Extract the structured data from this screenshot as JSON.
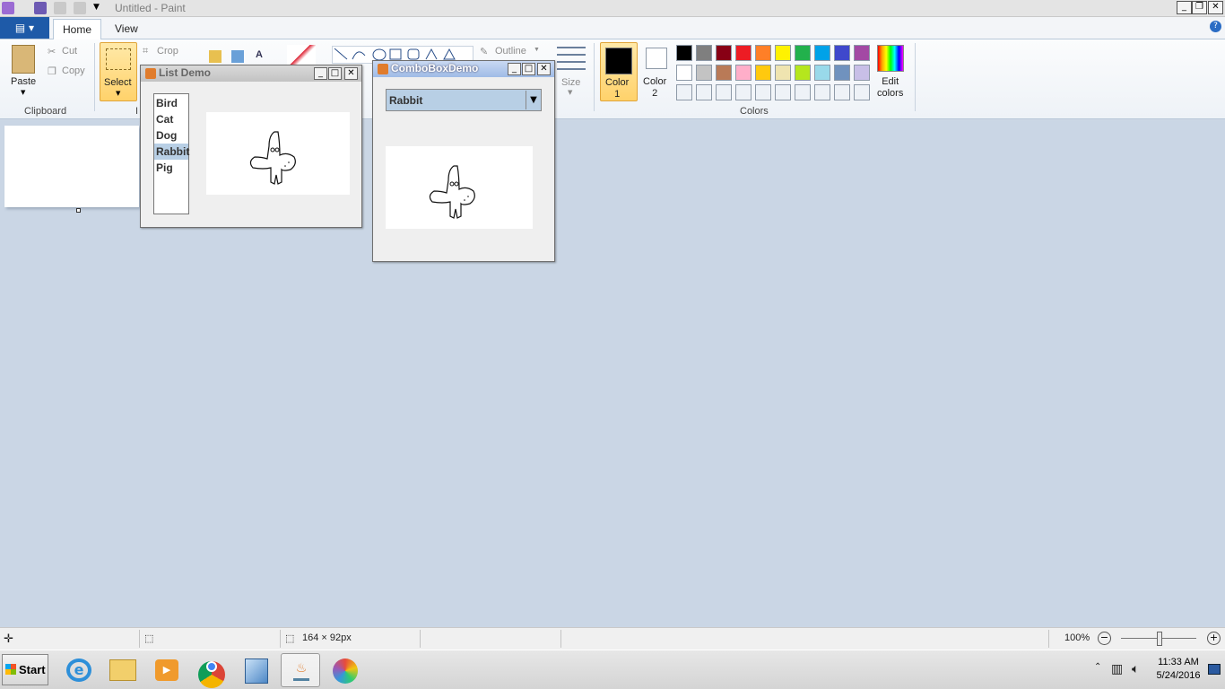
{
  "paint": {
    "title": "Untitled - Paint",
    "tabs": {
      "home": "Home",
      "view": "View"
    },
    "ribbon": {
      "paste": "Paste",
      "cut": "Cut",
      "copy": "Copy",
      "clipboard": "Clipboard",
      "select": "Select",
      "crop": "Crop",
      "image_group": "I",
      "outline": "Outline",
      "size": "Size",
      "color1": "Color\n1",
      "color2": "Color\n2",
      "colors_group": "Colors",
      "edit_colors": "Edit\ncolors",
      "palette_row1": [
        "#000000",
        "#7f7f7f",
        "#880015",
        "#ed1c24",
        "#ff7f27",
        "#fff200",
        "#22b14c",
        "#00a2e8",
        "#3f48cc",
        "#a349a4"
      ],
      "palette_row2": [
        "#ffffff",
        "#c3c3c3",
        "#b97a57",
        "#ffaec9",
        "#ffc90e",
        "#efe4b0",
        "#b5e61d",
        "#99d9ea",
        "#7092be",
        "#c8bfe7"
      ]
    },
    "status": {
      "size": "164 × 92px",
      "zoom": "100%"
    }
  },
  "list_demo": {
    "title": "List Demo",
    "items": [
      "Bird",
      "Cat",
      "Dog",
      "Rabbit",
      "Pig"
    ],
    "selected": "Rabbit"
  },
  "combo_demo": {
    "title": "ComboBoxDemo",
    "selected": "Rabbit"
  },
  "taskbar": {
    "start": "Start",
    "time": "11:33 AM",
    "date": "5/24/2016"
  },
  "colors": {
    "accent": "#1e5aa8",
    "selection": "#b8cfe5",
    "ribbon_active": "#ffd26b"
  }
}
